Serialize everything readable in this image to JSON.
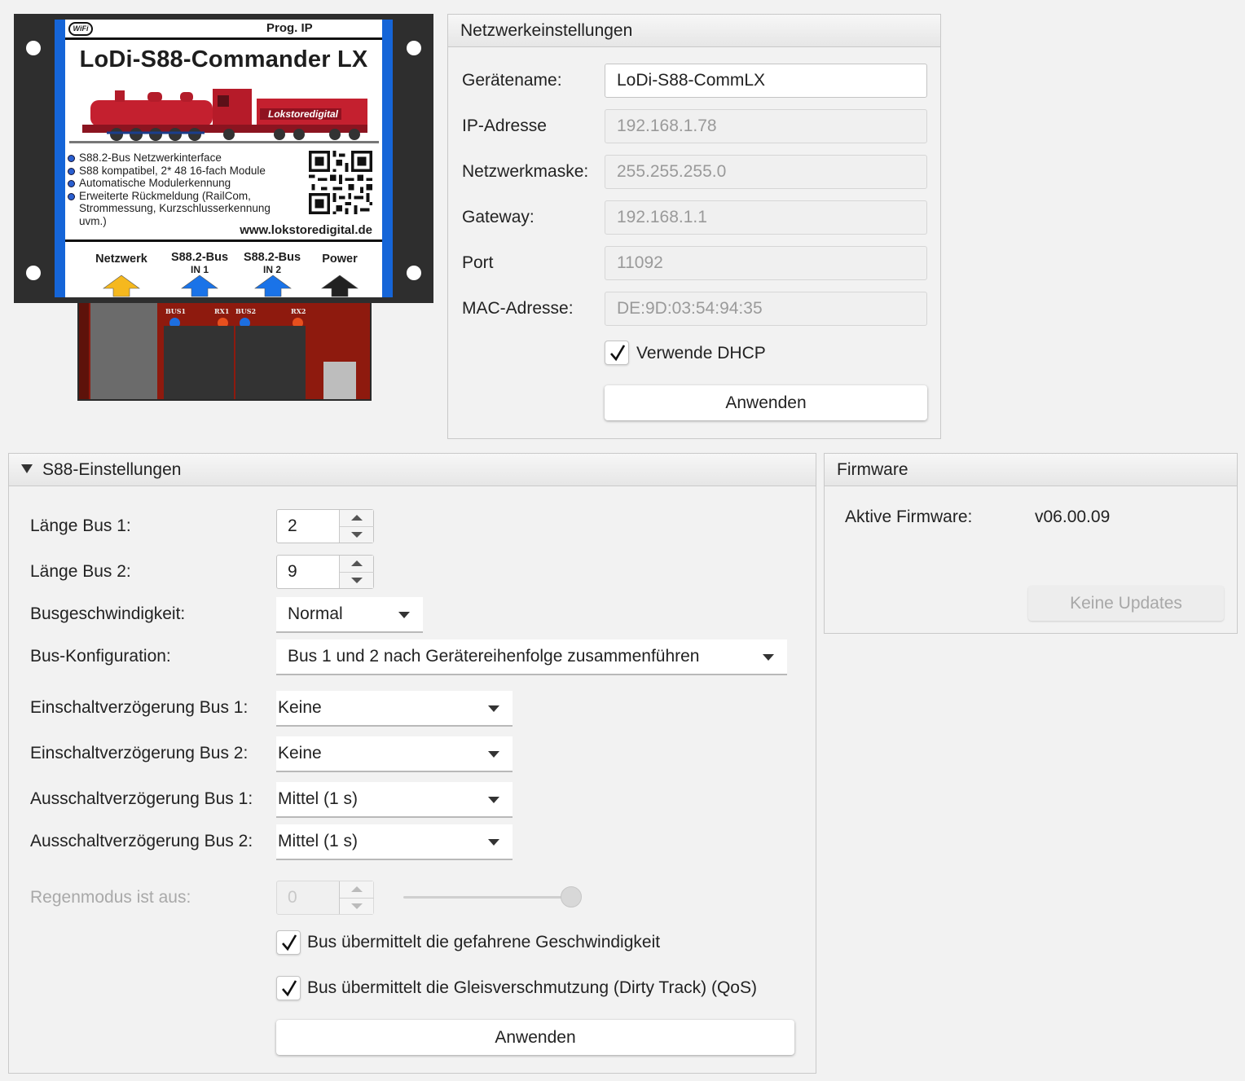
{
  "device": {
    "wifi_badge": "WiFi",
    "prog_ip": "Prog. IP",
    "title": "LoDi-S88-Commander LX",
    "brand_badge": "Lokstoredigital",
    "features": [
      "S88.2-Bus Netzwerkinterface",
      "S88 kompatibel, 2* 48 16-fach Module",
      "Automatische Modulerkennung",
      "Erweiterte Rückmeldung (RailCom,"
    ],
    "feature_continuation": [
      "Strommessung, Kurzschlusserkennung",
      "uvm.)"
    ],
    "url": "www.lokstoredigital.de",
    "ports": [
      {
        "label": "Netzwerk",
        "sub": "",
        "arrow_color": "#f5b81e"
      },
      {
        "label": "S88.2-Bus",
        "sub": "IN 1",
        "arrow_color": "#1a73e8"
      },
      {
        "label": "S88.2-Bus",
        "sub": "IN 2",
        "arrow_color": "#1a73e8"
      },
      {
        "label": "Power",
        "sub": "",
        "arrow_color": "#222222"
      }
    ],
    "board_labels": {
      "bus1": "BUS1",
      "rx1": "RX1",
      "bus2": "BUS2",
      "rx2": "RX2"
    }
  },
  "network": {
    "title": "Netzwerkeinstellungen",
    "device_name_label": "Gerätename:",
    "device_name_value": "LoDi-S88-CommLX",
    "ip_label": "IP-Adresse",
    "ip_value": "192.168.1.78",
    "mask_label": "Netzwerkmaske:",
    "mask_value": "255.255.255.0",
    "gateway_label": "Gateway:",
    "gateway_value": "192.168.1.1",
    "port_label": "Port",
    "port_value": "11092",
    "mac_label": "MAC-Adresse:",
    "mac_value": "DE:9D:03:54:94:35",
    "dhcp_label": "Verwende DHCP",
    "dhcp_checked": true,
    "apply_label": "Anwenden"
  },
  "s88": {
    "title": "S88-Einstellungen",
    "bus1_len_label": "Länge Bus 1:",
    "bus1_len_value": "2",
    "bus2_len_label": "Länge Bus 2:",
    "bus2_len_value": "9",
    "speed_label": "Busgeschwindigkeit:",
    "speed_value": "Normal",
    "config_label": "Bus-Konfiguration:",
    "config_value": "Bus 1 und 2 nach Gerätereihenfolge zusammenführen",
    "on_delay1_label": "Einschaltverzögerung Bus 1:",
    "on_delay1_value": "Keine",
    "on_delay2_label": "Einschaltverzögerung Bus 2:",
    "on_delay2_value": "Keine",
    "off_delay1_label": "Ausschaltverzögerung Bus 1:",
    "off_delay1_value": "Mittel (1 s)",
    "off_delay2_label": "Ausschaltverzögerung Bus 2:",
    "off_delay2_value": "Mittel (1 s)",
    "rain_label": "Regenmodus ist aus:",
    "rain_value": "0",
    "rain_slider_fraction": 1.0,
    "speed_report_label": "Bus übermittelt die gefahrene Geschwindigkeit",
    "speed_report_checked": true,
    "dirty_track_label": "Bus übermittelt die Gleisverschmutzung (Dirty Track) (QoS)",
    "dirty_track_checked": true,
    "apply_label": "Anwenden"
  },
  "firmware": {
    "title": "Firmware",
    "active_label": "Aktive Firmware:",
    "active_value": "v06.00.09",
    "update_label": "Keine Updates"
  }
}
